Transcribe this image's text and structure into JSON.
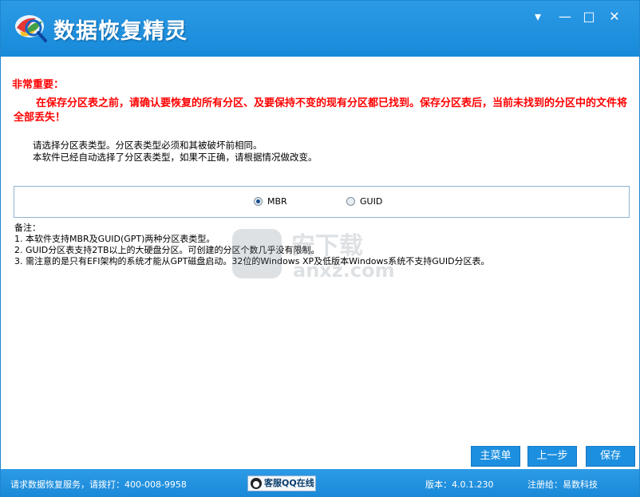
{
  "app": {
    "title": "数据恢复精灵"
  },
  "window_controls": {
    "menu": "▾",
    "minimize": "—",
    "maximize": "□",
    "close": "✕"
  },
  "warning": {
    "title": "非常重要：",
    "text": "在保存分区表之前，请确认要恢复的所有分区、及要保持不变的现有分区都已找到。保存分区表后，当前未找到的分区中的文件将全部丢失！"
  },
  "instructions": {
    "line1": "请选择分区表类型。分区表类型必须和其被破坏前相同。",
    "line2": "本软件已经自动选择了分区表类型，如果不正确，请根据情况做改变。"
  },
  "partition_type": {
    "options": [
      {
        "label": "MBR",
        "selected": true
      },
      {
        "label": "GUID",
        "selected": false
      }
    ]
  },
  "notes": {
    "title": "备注：",
    "items": [
      "1. 本软件支持MBR及GUID(GPT)两种分区表类型。",
      "2. GUID分区表支持2TB以上的大硬盘分区。可创建的分区个数几乎没有限制。",
      "3. 需注意的是只有EFI架构的系统才能从GPT磁盘启动。32位的Windows XP及低版本Windows系统不支持GUID分区表。"
    ]
  },
  "watermark": {
    "text": "安下载",
    "url": "anxz.com"
  },
  "buttons": {
    "main_menu": "主菜单",
    "previous": "上一步",
    "save": "保存"
  },
  "status": {
    "service": "请求数据恢复服务，请拨打：400-008-9958",
    "qq_service": "客服QQ在线",
    "version": "版本：4.0.1.230",
    "registered": "注册给：易数科技"
  },
  "colors": {
    "accent": "#1c8fe0",
    "warning": "#ff0000"
  }
}
